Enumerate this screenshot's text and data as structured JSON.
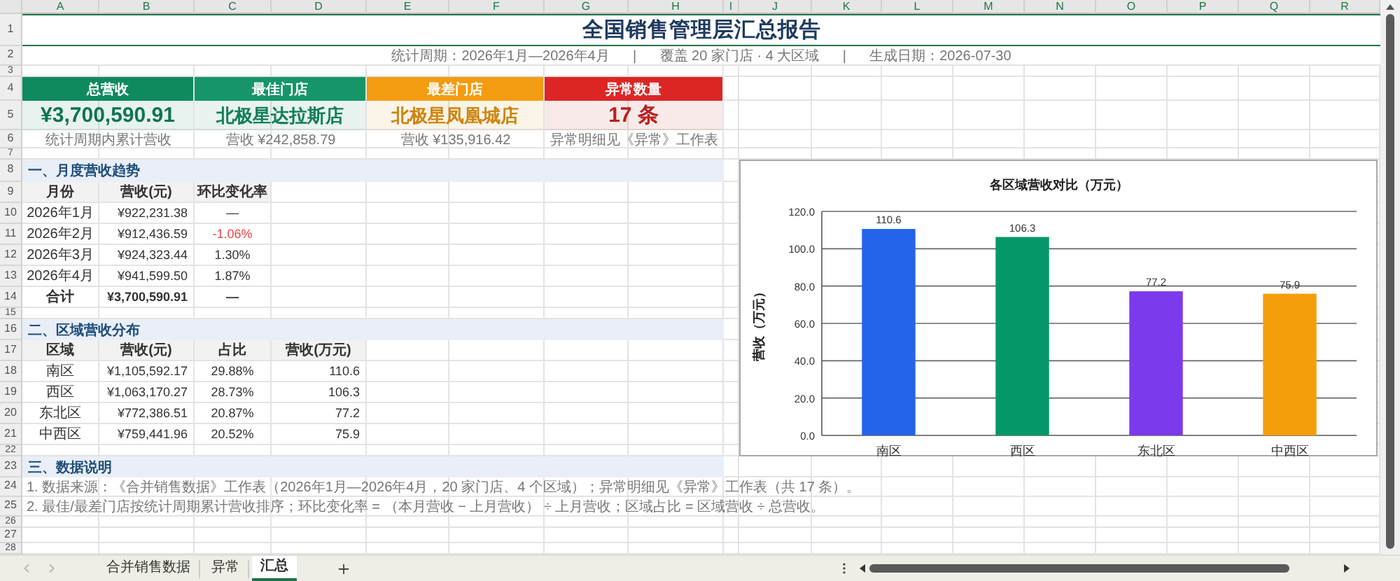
{
  "sheet": {
    "columns": [
      "A",
      "B",
      "C",
      "D",
      "E",
      "F",
      "G",
      "H",
      "I",
      "J",
      "K",
      "L",
      "M",
      "N",
      "O",
      "P",
      "Q",
      "R"
    ],
    "rows": [
      "1",
      "2",
      "3",
      "4",
      "5",
      "6",
      "7",
      "8",
      "9",
      "10",
      "11",
      "12",
      "13",
      "14",
      "15",
      "16",
      "17",
      "18",
      "19",
      "20",
      "21",
      "22",
      "23",
      "24",
      "25",
      "26",
      "27",
      "28"
    ]
  },
  "report": {
    "title": "全国销售管理层汇总报告",
    "subtitle": "统计周期：2026年1月—2026年4月      |      覆盖 20 家门店 · 4 大区域      |      生成日期：2026-07-30"
  },
  "kpis": [
    {
      "label": "总营收",
      "value": "¥3,700,590.91",
      "note": "统计周期内累计营收",
      "color": "#0f8a5f"
    },
    {
      "label": "最佳门店",
      "value": "北极星达拉斯店",
      "note": "营收 ¥242,858.79",
      "color": "#16956a"
    },
    {
      "label": "最差门店",
      "value": "北极星凤凰城店",
      "note": "营收 ¥135,916.42",
      "color": "#f39c12"
    },
    {
      "label": "异常数量",
      "value": "17 条",
      "note": "异常明细见《异常》工作表",
      "color": "#dc2626"
    }
  ],
  "monthly": {
    "heading": "一、月度营收趋势",
    "columns": [
      "月份",
      "营收(元)",
      "环比变化率"
    ],
    "rows": [
      {
        "kind": "data",
        "negative": false,
        "cells": [
          "2026年1月",
          "¥922,231.38",
          "—"
        ]
      },
      {
        "kind": "data",
        "negative": true,
        "cells": [
          "2026年2月",
          "¥912,436.59",
          "-1.06%"
        ]
      },
      {
        "kind": "data",
        "negative": false,
        "cells": [
          "2026年3月",
          "¥924,323.44",
          "1.30%"
        ]
      },
      {
        "kind": "data",
        "negative": false,
        "cells": [
          "2026年4月",
          "¥941,599.50",
          "1.87%"
        ]
      },
      {
        "kind": "total",
        "negative": false,
        "cells": [
          "合计",
          "¥3,700,590.91",
          "—"
        ]
      }
    ]
  },
  "regional": {
    "heading": "二、区域营收分布",
    "columns": [
      "区域",
      "营收(元)",
      "占比",
      "营收(万元)"
    ],
    "rows": [
      {
        "cells": [
          "南区",
          "¥1,105,592.17",
          "29.88%",
          "110.6"
        ]
      },
      {
        "cells": [
          "西区",
          "¥1,063,170.27",
          "28.73%",
          "106.3"
        ]
      },
      {
        "cells": [
          "东北区",
          "¥772,386.51",
          "20.87%",
          "77.2"
        ]
      },
      {
        "cells": [
          "中西区",
          "¥759,441.96",
          "20.52%",
          "75.9"
        ]
      }
    ]
  },
  "notes": {
    "heading": "三、数据说明",
    "lines": [
      "1. 数据来源：《合并销售数据》工作表（2026年1月—2026年4月，20 家门店、4 个区域）；异常明细见《异常》工作表（共 17 条）。",
      "2. 最佳/最差门店按统计周期累计营收排序；环比变化率 = （本月营收 − 上月营收） ÷ 上月营收；区域占比 = 区域营收 ÷ 总营收。"
    ]
  },
  "chart": {
    "chart_data": {
      "type": "bar",
      "title": "各区域营收对比（万元）",
      "ylabel": "营收（万元）",
      "categories": [
        "南区",
        "西区",
        "东北区",
        "中西区"
      ],
      "series": [
        {
          "values": [
            110.6,
            106.3,
            77.2,
            75.9
          ],
          "colors": [
            "#2563eb",
            "#059669",
            "#7c3aed",
            "#f59e0b"
          ]
        }
      ],
      "ylim": [
        0,
        120
      ],
      "yticks": [
        {
          "value": 0,
          "label": "0.0"
        },
        {
          "value": 20,
          "label": "20.0"
        },
        {
          "value": 40,
          "label": "40.0"
        },
        {
          "value": 60,
          "label": "60.0"
        },
        {
          "value": 80,
          "label": "80.0"
        },
        {
          "value": 100,
          "label": "100.0"
        },
        {
          "value": 120,
          "label": "120.0"
        }
      ],
      "data_labels": true,
      "grid": true,
      "value_labels": [
        "110.6",
        "106.3",
        "77.2",
        "75.9"
      ]
    }
  },
  "tabs": [
    {
      "label": "合并销售数据",
      "selected": false
    },
    {
      "label": "异常",
      "selected": false
    },
    {
      "label": "汇总",
      "selected": true
    }
  ]
}
